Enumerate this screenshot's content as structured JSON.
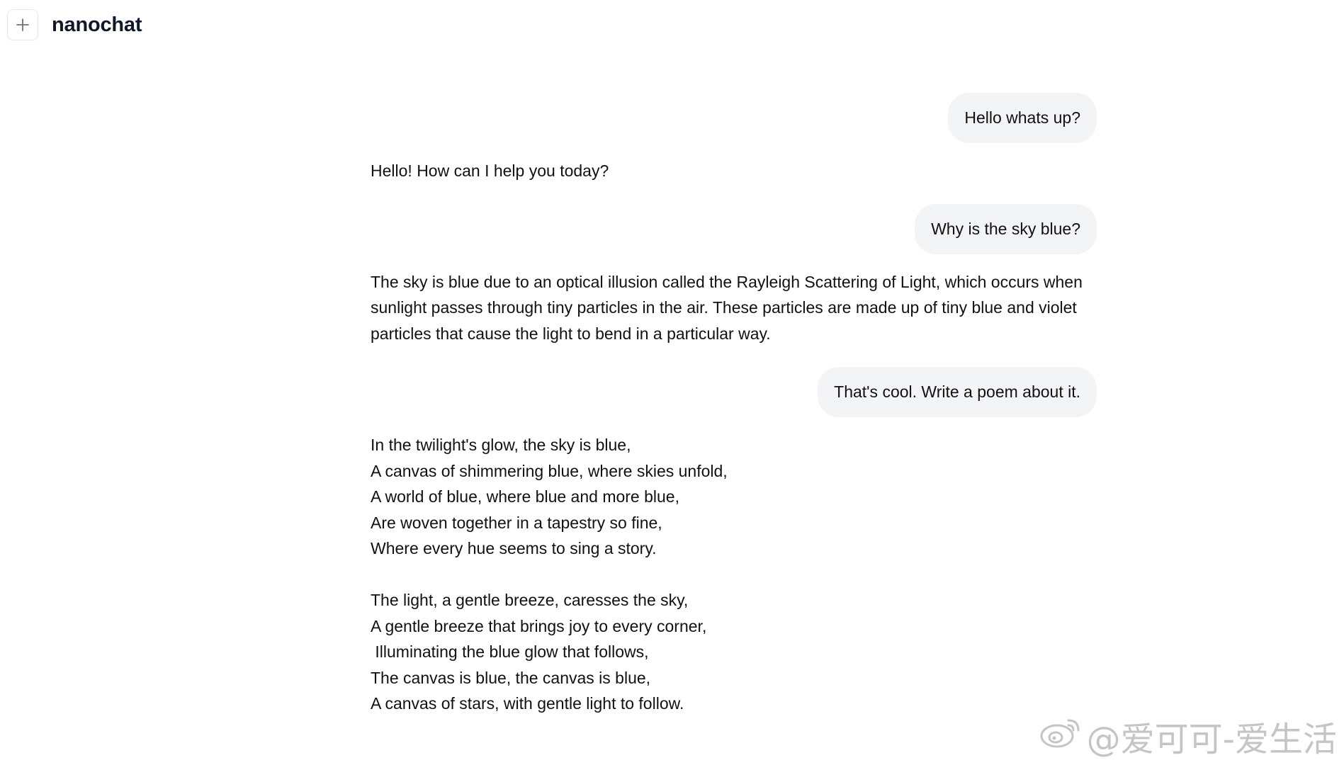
{
  "header": {
    "title": "nanochat",
    "new_chat_icon": "plus-icon"
  },
  "messages": [
    {
      "role": "user",
      "text": "Hello whats up?"
    },
    {
      "role": "assistant",
      "text": "Hello! How can I help you today?"
    },
    {
      "role": "user",
      "text": "Why is the sky blue?"
    },
    {
      "role": "assistant",
      "lines": [
        "The sky is blue due to an optical illusion called the Rayleigh Scattering of Light, which occurs when",
        "sunlight passes through tiny particles in the air. These particles are made up of tiny blue and violet",
        "particles that cause the light to bend in a particular way."
      ]
    },
    {
      "role": "user",
      "text": "That's cool. Write a poem about it."
    },
    {
      "role": "assistant",
      "poem": [
        [
          "In the twilight's glow, the sky is blue,",
          "A canvas of shimmering blue, where skies unfold,",
          "A world of blue, where blue and more blue,",
          "Are woven together in a tapestry so fine,",
          "Where every hue seems to sing a story."
        ],
        [
          "The light, a gentle breeze, caresses the sky,",
          "A gentle breeze that brings joy to every corner,",
          " Illuminating the blue glow that follows,",
          "The canvas is blue, the canvas is blue,",
          "A canvas of stars, with gentle light to follow."
        ]
      ]
    }
  ],
  "watermark": {
    "text": "@爱可可-爱生活",
    "icon": "weibo-icon"
  },
  "colors": {
    "bubble_bg": "#f3f4f6",
    "border": "#e5e7eb",
    "text": "#111111"
  }
}
